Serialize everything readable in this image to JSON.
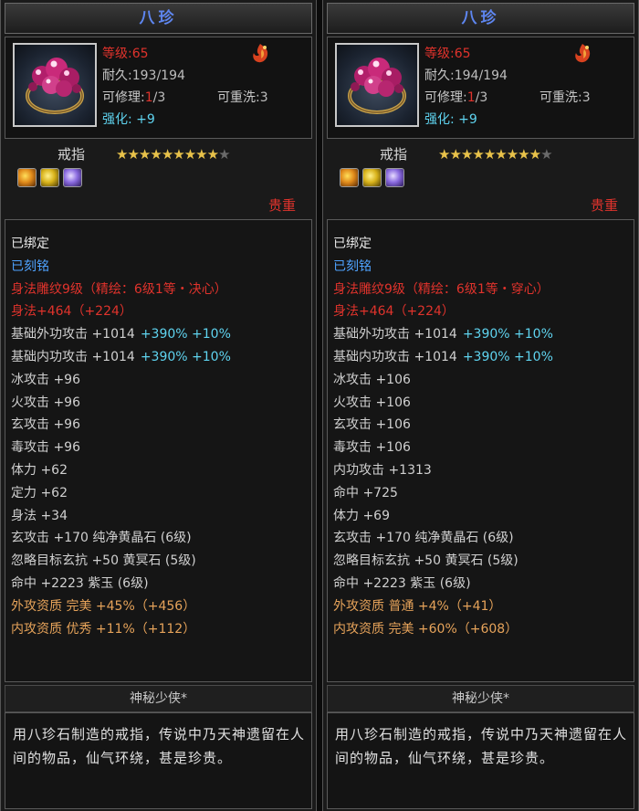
{
  "panels": [
    {
      "title": "八珍",
      "level_label": "等级",
      "level_value": ":65",
      "durability_label": "耐久",
      "durability_value": ":193/194",
      "repair_label": "可修理",
      "repair_sep": ":",
      "repair_current": "1",
      "repair_total": "/3",
      "rewash_label": "可重洗",
      "rewash_value": ":3",
      "enhance_label": "强化",
      "enhance_value": ": +9",
      "item_type": "戒指",
      "stars_filled": 9,
      "stars_total": 10,
      "gem_icons": [
        "orange-gem-icon",
        "yellow-gem-icon",
        "purple-gem-icon"
      ],
      "rarity": "贵重",
      "attributes": [
        {
          "parts": [
            {
              "text": "已绑定",
              "color": "white"
            }
          ]
        },
        {
          "parts": [
            {
              "text": "已刻铭",
              "color": "blue"
            }
          ]
        },
        {
          "parts": [
            {
              "text": "身法雕纹9级（精绘：6级1等・决心）",
              "color": "red"
            }
          ]
        },
        {
          "parts": [
            {
              "text": "身法+464（+224）",
              "color": "red"
            }
          ]
        },
        {
          "parts": [
            {
              "text": "基础外功攻击 +1014",
              "color": "gray"
            },
            {
              "text": "+390% +10%",
              "color": "cyan"
            }
          ]
        },
        {
          "parts": [
            {
              "text": "基础内功攻击 +1014",
              "color": "gray"
            },
            {
              "text": "+390% +10%",
              "color": "cyan"
            }
          ]
        },
        {
          "parts": [
            {
              "text": "冰攻击 +96",
              "color": "gray"
            }
          ]
        },
        {
          "parts": [
            {
              "text": "火攻击 +96",
              "color": "gray"
            }
          ]
        },
        {
          "parts": [
            {
              "text": "玄攻击 +96",
              "color": "gray"
            }
          ]
        },
        {
          "parts": [
            {
              "text": "毒攻击 +96",
              "color": "gray"
            }
          ]
        },
        {
          "parts": [
            {
              "text": "体力 +62",
              "color": "gray"
            }
          ]
        },
        {
          "parts": [
            {
              "text": "定力 +62",
              "color": "gray"
            }
          ]
        },
        {
          "parts": [
            {
              "text": "身法 +34",
              "color": "gray"
            }
          ]
        },
        {
          "parts": [
            {
              "text": "玄攻击 +170 纯净黄晶石 (6级)",
              "color": "gray"
            }
          ]
        },
        {
          "parts": [
            {
              "text": "忽略目标玄抗 +50 黄冥石 (5级)",
              "color": "gray"
            }
          ]
        },
        {
          "parts": [
            {
              "text": "命中 +2223 紫玉 (6级)",
              "color": "gray"
            }
          ]
        },
        {
          "parts": [
            {
              "text": "外攻资质 完美 +45%（+456）",
              "color": "orange"
            }
          ]
        },
        {
          "parts": [
            {
              "text": "内攻资质 优秀 +11%（+112）",
              "color": "orange"
            }
          ]
        }
      ],
      "maker": "神秘少侠*",
      "description": "用八珍石制造的戒指，传说中乃天神遗留在人间的物品，仙气环绕，甚是珍贵。"
    },
    {
      "title": "八珍",
      "level_label": "等级",
      "level_value": ":65",
      "durability_label": "耐久",
      "durability_value": ":194/194",
      "repair_label": "可修理",
      "repair_sep": ":",
      "repair_current": "1",
      "repair_total": "/3",
      "rewash_label": "可重洗",
      "rewash_value": ":3",
      "enhance_label": "强化",
      "enhance_value": ": +9",
      "item_type": "戒指",
      "stars_filled": 9,
      "stars_total": 10,
      "gem_icons": [
        "orange-gem-icon",
        "yellow-gem-icon",
        "purple-gem-icon"
      ],
      "rarity": "贵重",
      "attributes": [
        {
          "parts": [
            {
              "text": "已绑定",
              "color": "white"
            }
          ]
        },
        {
          "parts": [
            {
              "text": "已刻铭",
              "color": "blue"
            }
          ]
        },
        {
          "parts": [
            {
              "text": "身法雕纹9级（精绘：6级1等・穿心）",
              "color": "red"
            }
          ]
        },
        {
          "parts": [
            {
              "text": "身法+464（+224）",
              "color": "red"
            }
          ]
        },
        {
          "parts": [
            {
              "text": "基础外功攻击 +1014",
              "color": "gray"
            },
            {
              "text": "+390% +10%",
              "color": "cyan"
            }
          ]
        },
        {
          "parts": [
            {
              "text": "基础内功攻击 +1014",
              "color": "gray"
            },
            {
              "text": "+390% +10%",
              "color": "cyan"
            }
          ]
        },
        {
          "parts": [
            {
              "text": "冰攻击 +106",
              "color": "gray"
            }
          ]
        },
        {
          "parts": [
            {
              "text": "火攻击 +106",
              "color": "gray"
            }
          ]
        },
        {
          "parts": [
            {
              "text": "玄攻击 +106",
              "color": "gray"
            }
          ]
        },
        {
          "parts": [
            {
              "text": "毒攻击 +106",
              "color": "gray"
            }
          ]
        },
        {
          "parts": [
            {
              "text": "内功攻击 +1313",
              "color": "gray"
            }
          ]
        },
        {
          "parts": [
            {
              "text": "命中 +725",
              "color": "gray"
            }
          ]
        },
        {
          "parts": [
            {
              "text": "体力 +69",
              "color": "gray"
            }
          ]
        },
        {
          "parts": [
            {
              "text": "玄攻击 +170 纯净黄晶石 (6级)",
              "color": "gray"
            }
          ]
        },
        {
          "parts": [
            {
              "text": "忽略目标玄抗 +50 黄冥石 (5级)",
              "color": "gray"
            }
          ]
        },
        {
          "parts": [
            {
              "text": "命中 +2223 紫玉 (6级)",
              "color": "gray"
            }
          ]
        },
        {
          "parts": [
            {
              "text": "外攻资质 普通 +4%（+41）",
              "color": "orange"
            }
          ]
        },
        {
          "parts": [
            {
              "text": "内攻资质 完美 +60%（+608）",
              "color": "orange"
            }
          ]
        }
      ],
      "maker": "神秘少侠*",
      "description": "用八珍石制造的戒指，传说中乃天神遗留在人间的物品，仙气环绕，甚是珍贵。"
    }
  ],
  "colors": {
    "red": "#e0332c",
    "cyan": "#5fd4f0",
    "blue": "#4fa3ff",
    "orange": "#e6a35a",
    "gold_star": "#e8c24a",
    "title_blue": "#5e86f0"
  }
}
